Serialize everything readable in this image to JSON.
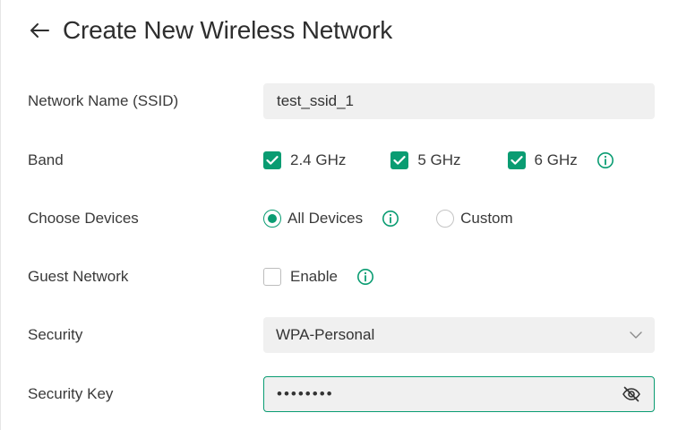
{
  "header": {
    "title": "Create New Wireless Network"
  },
  "form": {
    "ssid": {
      "label": "Network Name (SSID)",
      "value": "test_ssid_1"
    },
    "band": {
      "label": "Band",
      "options": [
        {
          "label": "2.4 GHz",
          "checked": true
        },
        {
          "label": "5 GHz",
          "checked": true
        },
        {
          "label": "6 GHz",
          "checked": true
        }
      ]
    },
    "devices": {
      "label": "Choose Devices",
      "options": [
        {
          "label": "All Devices",
          "selected": true
        },
        {
          "label": "Custom",
          "selected": false
        }
      ]
    },
    "guest": {
      "label": "Guest Network",
      "option_label": "Enable",
      "checked": false
    },
    "security": {
      "label": "Security",
      "value": "WPA-Personal"
    },
    "security_key": {
      "label": "Security Key",
      "masked_value": "••••••••"
    }
  },
  "colors": {
    "accent": "#0a9c72",
    "field_bg": "#f0f0f0",
    "text": "#333333"
  },
  "icons": {
    "back": "arrow-left-icon",
    "info": "info-circle-icon",
    "dropdown": "chevron-down-icon",
    "visibility": "eye-slash-icon"
  }
}
